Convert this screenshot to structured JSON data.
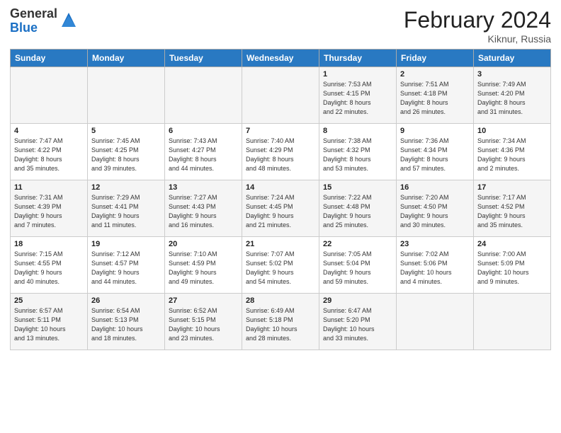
{
  "header": {
    "logo_general": "General",
    "logo_blue": "Blue",
    "month_title": "February 2024",
    "location": "Kiknur, Russia"
  },
  "weekdays": [
    "Sunday",
    "Monday",
    "Tuesday",
    "Wednesday",
    "Thursday",
    "Friday",
    "Saturday"
  ],
  "weeks": [
    [
      {
        "day": "",
        "info": ""
      },
      {
        "day": "",
        "info": ""
      },
      {
        "day": "",
        "info": ""
      },
      {
        "day": "",
        "info": ""
      },
      {
        "day": "1",
        "info": "Sunrise: 7:53 AM\nSunset: 4:15 PM\nDaylight: 8 hours\nand 22 minutes."
      },
      {
        "day": "2",
        "info": "Sunrise: 7:51 AM\nSunset: 4:18 PM\nDaylight: 8 hours\nand 26 minutes."
      },
      {
        "day": "3",
        "info": "Sunrise: 7:49 AM\nSunset: 4:20 PM\nDaylight: 8 hours\nand 31 minutes."
      }
    ],
    [
      {
        "day": "4",
        "info": "Sunrise: 7:47 AM\nSunset: 4:22 PM\nDaylight: 8 hours\nand 35 minutes."
      },
      {
        "day": "5",
        "info": "Sunrise: 7:45 AM\nSunset: 4:25 PM\nDaylight: 8 hours\nand 39 minutes."
      },
      {
        "day": "6",
        "info": "Sunrise: 7:43 AM\nSunset: 4:27 PM\nDaylight: 8 hours\nand 44 minutes."
      },
      {
        "day": "7",
        "info": "Sunrise: 7:40 AM\nSunset: 4:29 PM\nDaylight: 8 hours\nand 48 minutes."
      },
      {
        "day": "8",
        "info": "Sunrise: 7:38 AM\nSunset: 4:32 PM\nDaylight: 8 hours\nand 53 minutes."
      },
      {
        "day": "9",
        "info": "Sunrise: 7:36 AM\nSunset: 4:34 PM\nDaylight: 8 hours\nand 57 minutes."
      },
      {
        "day": "10",
        "info": "Sunrise: 7:34 AM\nSunset: 4:36 PM\nDaylight: 9 hours\nand 2 minutes."
      }
    ],
    [
      {
        "day": "11",
        "info": "Sunrise: 7:31 AM\nSunset: 4:39 PM\nDaylight: 9 hours\nand 7 minutes."
      },
      {
        "day": "12",
        "info": "Sunrise: 7:29 AM\nSunset: 4:41 PM\nDaylight: 9 hours\nand 11 minutes."
      },
      {
        "day": "13",
        "info": "Sunrise: 7:27 AM\nSunset: 4:43 PM\nDaylight: 9 hours\nand 16 minutes."
      },
      {
        "day": "14",
        "info": "Sunrise: 7:24 AM\nSunset: 4:45 PM\nDaylight: 9 hours\nand 21 minutes."
      },
      {
        "day": "15",
        "info": "Sunrise: 7:22 AM\nSunset: 4:48 PM\nDaylight: 9 hours\nand 25 minutes."
      },
      {
        "day": "16",
        "info": "Sunrise: 7:20 AM\nSunset: 4:50 PM\nDaylight: 9 hours\nand 30 minutes."
      },
      {
        "day": "17",
        "info": "Sunrise: 7:17 AM\nSunset: 4:52 PM\nDaylight: 9 hours\nand 35 minutes."
      }
    ],
    [
      {
        "day": "18",
        "info": "Sunrise: 7:15 AM\nSunset: 4:55 PM\nDaylight: 9 hours\nand 40 minutes."
      },
      {
        "day": "19",
        "info": "Sunrise: 7:12 AM\nSunset: 4:57 PM\nDaylight: 9 hours\nand 44 minutes."
      },
      {
        "day": "20",
        "info": "Sunrise: 7:10 AM\nSunset: 4:59 PM\nDaylight: 9 hours\nand 49 minutes."
      },
      {
        "day": "21",
        "info": "Sunrise: 7:07 AM\nSunset: 5:02 PM\nDaylight: 9 hours\nand 54 minutes."
      },
      {
        "day": "22",
        "info": "Sunrise: 7:05 AM\nSunset: 5:04 PM\nDaylight: 9 hours\nand 59 minutes."
      },
      {
        "day": "23",
        "info": "Sunrise: 7:02 AM\nSunset: 5:06 PM\nDaylight: 10 hours\nand 4 minutes."
      },
      {
        "day": "24",
        "info": "Sunrise: 7:00 AM\nSunset: 5:09 PM\nDaylight: 10 hours\nand 9 minutes."
      }
    ],
    [
      {
        "day": "25",
        "info": "Sunrise: 6:57 AM\nSunset: 5:11 PM\nDaylight: 10 hours\nand 13 minutes."
      },
      {
        "day": "26",
        "info": "Sunrise: 6:54 AM\nSunset: 5:13 PM\nDaylight: 10 hours\nand 18 minutes."
      },
      {
        "day": "27",
        "info": "Sunrise: 6:52 AM\nSunset: 5:15 PM\nDaylight: 10 hours\nand 23 minutes."
      },
      {
        "day": "28",
        "info": "Sunrise: 6:49 AM\nSunset: 5:18 PM\nDaylight: 10 hours\nand 28 minutes."
      },
      {
        "day": "29",
        "info": "Sunrise: 6:47 AM\nSunset: 5:20 PM\nDaylight: 10 hours\nand 33 minutes."
      },
      {
        "day": "",
        "info": ""
      },
      {
        "day": "",
        "info": ""
      }
    ]
  ]
}
